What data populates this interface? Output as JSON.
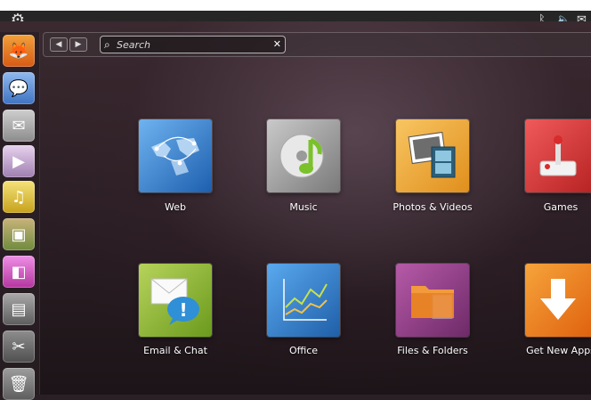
{
  "panel": {
    "indicators": [
      {
        "icon": "bluetooth-icon",
        "glyph": "✱"
      },
      {
        "icon": "volume-icon",
        "glyph": "🔊"
      },
      {
        "icon": "mail-icon",
        "glyph": "✉"
      }
    ]
  },
  "launcher": {
    "items": [
      {
        "name": "firefox",
        "glyph": "🦊",
        "color": "#e86f1f"
      },
      {
        "name": "empathy",
        "glyph": "☁",
        "color": "#5b8fd6"
      },
      {
        "name": "evolution",
        "glyph": "✉",
        "color": "#9a9a9a"
      },
      {
        "name": "movie-player",
        "glyph": "◉",
        "color": "#b9a0c6"
      },
      {
        "name": "rhythmbox",
        "glyph": "◉",
        "color": "#e3c23a"
      },
      {
        "name": "photo-manager",
        "glyph": "▣",
        "color": "#8aa05a"
      },
      {
        "name": "presentation",
        "glyph": "◧",
        "color": "#c35bbd"
      },
      {
        "name": "files",
        "glyph": "▤",
        "color": "#7a7a7a"
      },
      {
        "name": "tools",
        "glyph": "✂",
        "color": "#6b6b6b"
      },
      {
        "name": "trash",
        "glyph": "🗑",
        "color": "#8a8a8a"
      }
    ]
  },
  "dash": {
    "search_placeholder": "Search",
    "tiles": [
      {
        "label": "Web",
        "icon": "globe-icon",
        "color": "#2f7fd0"
      },
      {
        "label": "Music",
        "icon": "music-icon",
        "color": "#9a9a9a"
      },
      {
        "label": "Photos & Videos",
        "icon": "photos-icon",
        "color": "#f0a63a"
      },
      {
        "label": "Games",
        "icon": "joystick-icon",
        "color": "#d84040"
      },
      {
        "label": "Email & Chat",
        "icon": "email-chat-icon",
        "color": "#8ab431"
      },
      {
        "label": "Office",
        "icon": "chart-icon",
        "color": "#3585cf"
      },
      {
        "label": "Files & Folders",
        "icon": "folder-icon",
        "color": "#9a3e8f"
      },
      {
        "label": "Get New Apps",
        "icon": "download-icon",
        "color": "#f07a1a"
      }
    ]
  }
}
